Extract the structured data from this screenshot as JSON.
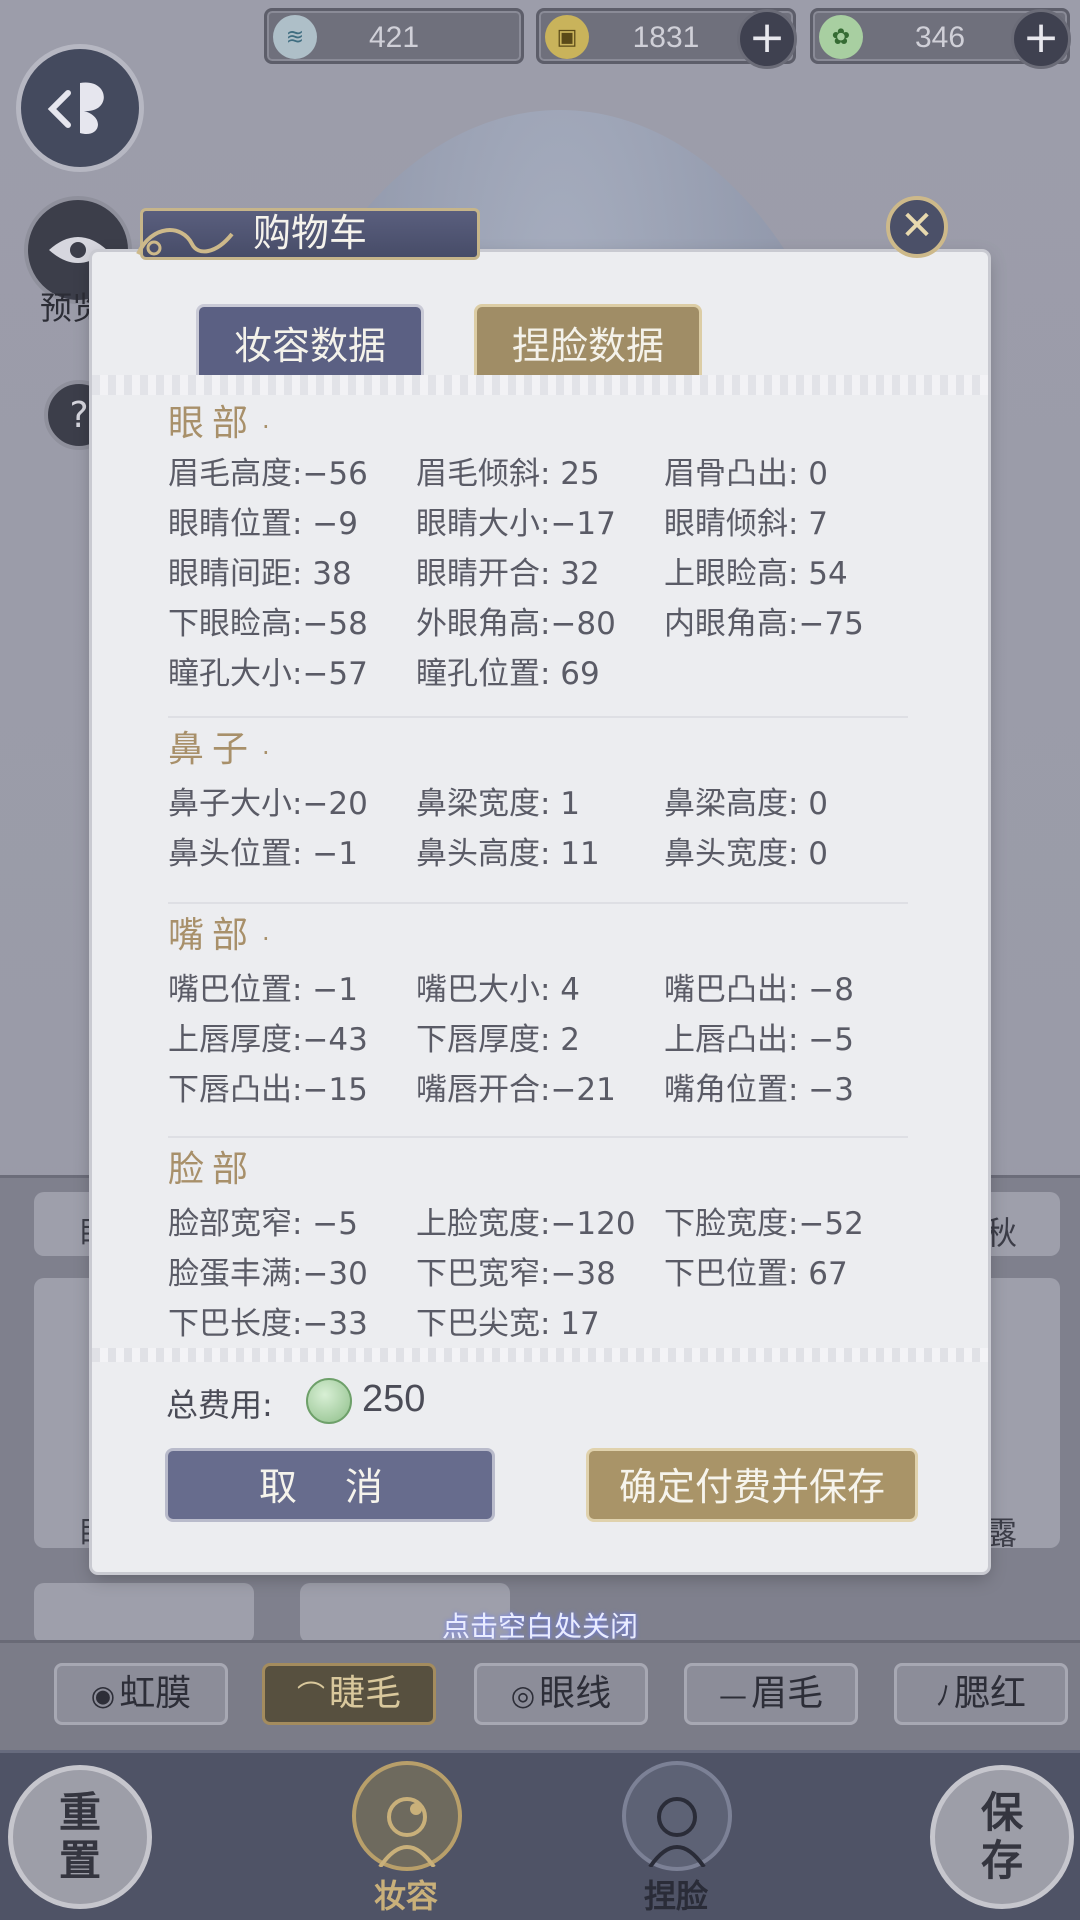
{
  "currencies": [
    {
      "icon": "jade-coin-icon",
      "value": "421"
    },
    {
      "icon": "copper-coin-icon",
      "value": "1831"
    },
    {
      "icon": "green-token-icon",
      "value": "346"
    }
  ],
  "side": {
    "preview_label": "预览",
    "help_glyph": "?"
  },
  "dialog": {
    "title": "购物车",
    "close_glyph": "✕",
    "tabs": [
      {
        "label": "妆容数据"
      },
      {
        "label": "捏脸数据"
      }
    ],
    "sections": [
      {
        "title": "眼部",
        "rows": [
          [
            "眉毛高度:−56",
            "眉毛倾斜: 25",
            "眉骨凸出:  0"
          ],
          [
            "眼睛位置: −9",
            "眼睛大小:−17",
            "眼睛倾斜:  7"
          ],
          [
            "眼睛间距: 38",
            "眼睛开合: 32",
            "上眼睑高: 54"
          ],
          [
            "下眼睑高:−58",
            "外眼角高:−80",
            "内眼角高:−75"
          ],
          [
            "瞳孔大小:−57",
            "瞳孔位置: 69",
            ""
          ]
        ]
      },
      {
        "title": "鼻子",
        "rows": [
          [
            "鼻子大小:−20",
            "鼻梁宽度:  1",
            "鼻梁高度:  0"
          ],
          [
            "鼻头位置: −1",
            "鼻头高度: 11",
            "鼻头宽度:  0"
          ]
        ]
      },
      {
        "title": "嘴部",
        "rows": [
          [
            "嘴巴位置: −1",
            "嘴巴大小:  4",
            "嘴巴凸出: −8"
          ],
          [
            "上唇厚度:−43",
            "下唇厚度:  2",
            "上唇凸出: −5"
          ],
          [
            "下唇凸出:−15",
            "嘴唇开合:−21",
            "嘴角位置: −3"
          ]
        ]
      },
      {
        "title": "脸部",
        "rows": [
          [
            "脸部宽窄: −5",
            "上脸宽度:−120",
            "下脸宽度:−52"
          ],
          [
            "脸蛋丰满:−30",
            "下巴宽窄:−38",
            "下巴位置: 67"
          ],
          [
            "下巴长度:−33",
            "下巴尖宽: 17",
            ""
          ]
        ]
      }
    ],
    "total_label": "总费用:",
    "total_value": "250",
    "cancel_label": "取 消",
    "confirm_label": "确定付费并保存"
  },
  "hint": "点击空白处关闭",
  "background_cards": {
    "left_top": "眼",
    "right_top": "秋",
    "left_mid": "眼",
    "right_mid": "露"
  },
  "category_tabs": [
    {
      "icon": "iris-icon",
      "glyph": "◉",
      "label": "虹膜"
    },
    {
      "icon": "eyelash-icon",
      "glyph": "⌒",
      "label": "睫毛",
      "active": true
    },
    {
      "icon": "eyeliner-icon",
      "glyph": "◎",
      "label": "眼线"
    },
    {
      "icon": "eyebrow-icon",
      "glyph": "—",
      "label": "眉毛"
    },
    {
      "icon": "blush-icon",
      "glyph": "ﾉ",
      "label": "腮红"
    }
  ],
  "bottom_nav": {
    "reset": [
      "重",
      "置"
    ],
    "makeup": "妆容",
    "face": "捏脸",
    "save": [
      "保",
      "存"
    ]
  },
  "colors": {
    "accent_gold": "#a8906a",
    "accent_purple": "#5b6083"
  }
}
